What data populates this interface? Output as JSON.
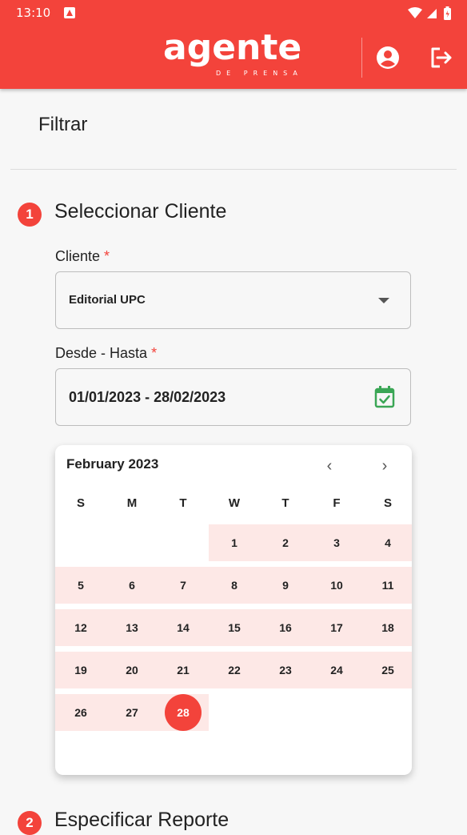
{
  "status_bar": {
    "time": "13:10"
  },
  "header": {
    "logo_text": "agente",
    "logo_subtitle": "DE PRENSA",
    "profile_icon": "account-circle-icon",
    "logout_icon": "logout-icon"
  },
  "page": {
    "title": "Filtrar"
  },
  "step1": {
    "number": "1",
    "title": "Seleccionar Cliente",
    "client_label": "Cliente",
    "client_value": "Editorial UPC",
    "range_label": "Desde - Hasta",
    "range_value": "01/01/2023 - 28/02/2023",
    "required_mark": "*"
  },
  "calendar": {
    "month_label": "February 2023",
    "prev": "‹",
    "next": "›",
    "weekdays": [
      "S",
      "M",
      "T",
      "W",
      "T",
      "F",
      "S"
    ],
    "days": [
      "1",
      "2",
      "3",
      "4",
      "5",
      "6",
      "7",
      "8",
      "9",
      "10",
      "11",
      "12",
      "13",
      "14",
      "15",
      "16",
      "17",
      "18",
      "19",
      "20",
      "21",
      "22",
      "23",
      "24",
      "25",
      "26",
      "27",
      "28"
    ],
    "selected_day": "28"
  },
  "step2": {
    "number": "2",
    "title": "Especificar Reporte"
  },
  "colors": {
    "brand": "#f3433b",
    "range_highlight": "#fde8e6",
    "calendar_icon": "#3aa655"
  }
}
